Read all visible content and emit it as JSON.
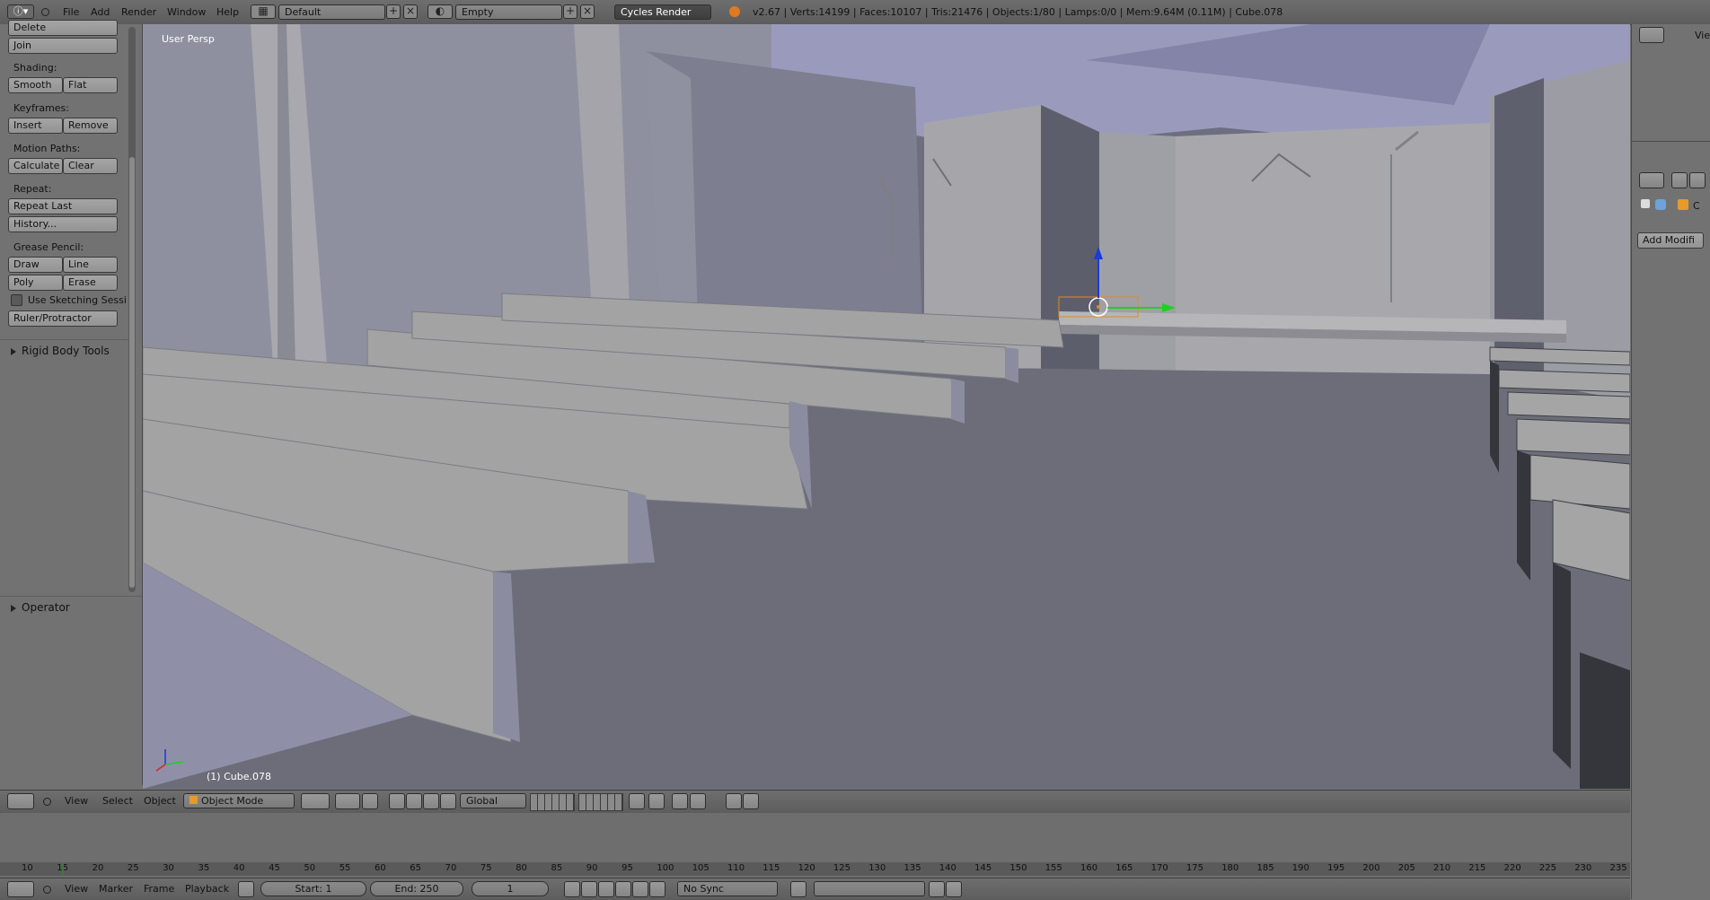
{
  "topbar": {
    "menus": [
      "File",
      "Add",
      "Render",
      "Window",
      "Help"
    ],
    "layout": "Default",
    "scene": "Empty",
    "engine": "Cycles Render",
    "stats": "v2.67 | Verts:14199 | Faces:10107 | Tris:21476 | Objects:1/80 | Lamps:0/0 | Mem:9.64M (0.11M) | Cube.078"
  },
  "toolshelf": {
    "top_buttons": [
      "Delete",
      "Join"
    ],
    "shading_label": "Shading:",
    "shading": [
      "Smooth",
      "Flat"
    ],
    "keyframes_label": "Keyframes:",
    "keyframes": [
      "Insert",
      "Remove"
    ],
    "motion_label": "Motion Paths:",
    "motion": [
      "Calculate",
      "Clear"
    ],
    "repeat_label": "Repeat:",
    "repeat_last": "Repeat Last",
    "history": "History...",
    "grease_label": "Grease Pencil:",
    "grease_row1": [
      "Draw",
      "Line"
    ],
    "grease_row2": [
      "Poly",
      "Erase"
    ],
    "sketching": "Use Sketching Sessi",
    "ruler": "Ruler/Protractor",
    "rigid_body": "Rigid Body Tools",
    "operator": "Operator"
  },
  "viewport": {
    "view_name": "User Persp",
    "object_label": "(1) Cube.078",
    "colors": {
      "wall": "#8e8e9c",
      "floor": "#6d6d78",
      "pew": "#a3a3a3",
      "ceiling": "#9a9bbc"
    }
  },
  "vp_header": {
    "menus": [
      "View",
      "Select",
      "Object"
    ],
    "mode": "Object Mode",
    "orientation": "Global"
  },
  "timeline": {
    "ticks": [
      "10",
      "15",
      "20",
      "25",
      "30",
      "35",
      "40",
      "45",
      "50",
      "55",
      "60",
      "65",
      "70",
      "75",
      "80",
      "85",
      "90",
      "95",
      "100",
      "105",
      "110",
      "115",
      "120",
      "125",
      "130",
      "135",
      "140",
      "145",
      "150",
      "155",
      "160",
      "165",
      "170",
      "175",
      "180",
      "185",
      "190",
      "195",
      "200",
      "205",
      "210",
      "215",
      "220",
      "225",
      "230",
      "235"
    ],
    "menus": [
      "View",
      "Marker",
      "Frame",
      "Playback"
    ],
    "start": "Start: 1",
    "end": "End: 250",
    "current": "1",
    "sync": "No Sync"
  },
  "rightpanel": {
    "view_label": "Vie",
    "c_label": "C",
    "add_modifier": "Add Modifi"
  }
}
